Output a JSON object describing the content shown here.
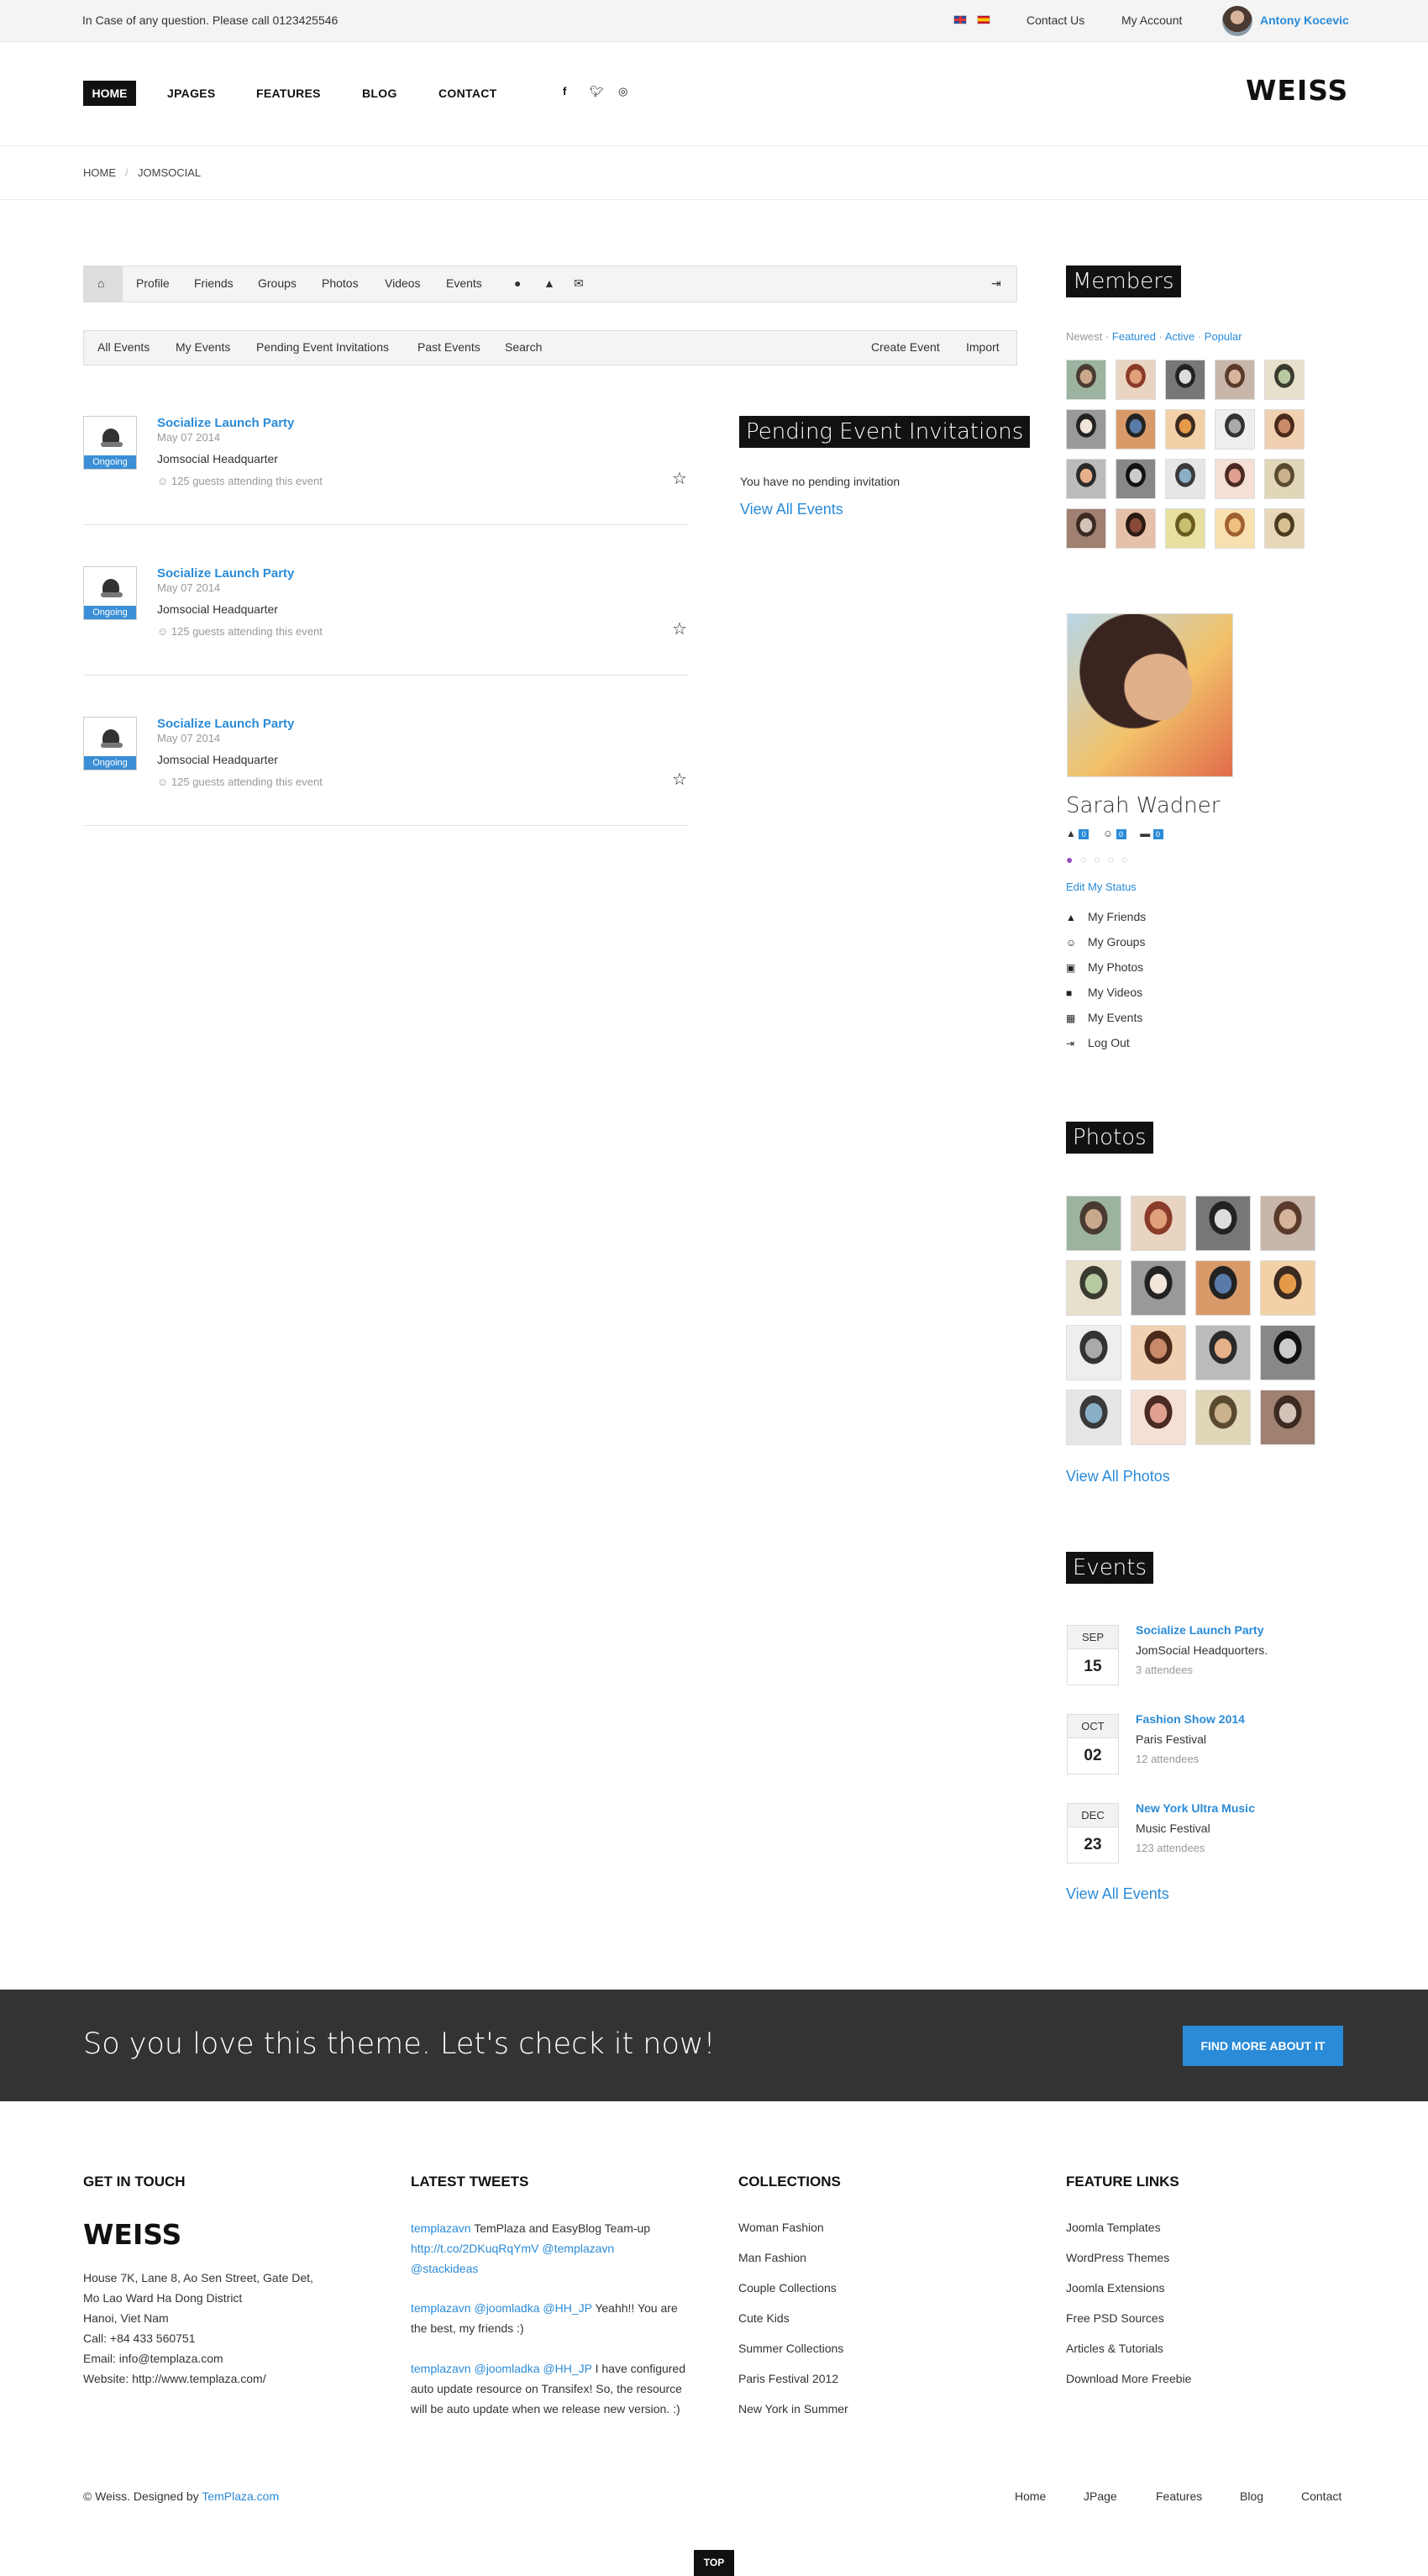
{
  "topbar": {
    "question": "In Case of any question. Please call 0123425546",
    "contact": "Contact Us",
    "account": "My Account",
    "user": "Antony Kocevic"
  },
  "nav": {
    "items": [
      "HOME",
      "JPAGES",
      "FEATURES",
      "BLOG",
      "CONTACT"
    ],
    "social": [
      "facebook-icon",
      "twitter-icon",
      "dribbble-icon"
    ]
  },
  "logo": "WEISS",
  "breadcrumb": [
    "HOME",
    "JOMSOCIAL"
  ],
  "toolbar_tabs": [
    "Profile",
    "Friends",
    "Groups",
    "Photos",
    "Videos",
    "Events"
  ],
  "subnav": {
    "left": [
      "All Events",
      "My Events",
      "Pending Event Invitations",
      "Past Events",
      "Search"
    ],
    "right": [
      "Create Event",
      "Import"
    ]
  },
  "events": [
    {
      "badge": "Ongoing",
      "title": "Socialize Launch Party",
      "date": "May 07 2014",
      "location": "Jomsocial Headquarter",
      "attending": "125 guests attending this event"
    },
    {
      "badge": "Ongoing",
      "title": "Socialize Launch Party",
      "date": "May 07 2014",
      "location": "Jomsocial Headquarter",
      "attending": "125 guests attending this event"
    },
    {
      "badge": "Ongoing",
      "title": "Socialize Launch Party",
      "date": "May 07 2014",
      "location": "Jomsocial Headquarter",
      "attending": "125 guests attending this event"
    }
  ],
  "pending": {
    "title": "Pending Event Invitations",
    "empty": "You have no pending invitation",
    "view_all": "View All Events"
  },
  "members": {
    "title": "Members",
    "filters": [
      "Newest",
      "Featured",
      "Active",
      "Popular"
    ]
  },
  "profile": {
    "name": "Sarah Wadner",
    "counts": [
      "0",
      "0",
      "0"
    ],
    "edit": "Edit My Status",
    "menu": [
      "My Friends",
      "My Groups",
      "My Photos",
      "My Videos",
      "My Events",
      "Log Out"
    ]
  },
  "photos": {
    "title": "Photos",
    "view_all": "View All Photos"
  },
  "side_events": {
    "title": "Events",
    "items": [
      {
        "month": "SEP",
        "day": "15",
        "title": "Socialize Launch Party",
        "place": "JomSocial Headquorters.",
        "attendees": "3 attendees"
      },
      {
        "month": "OCT",
        "day": "02",
        "title": "Fashion Show 2014",
        "place": "Paris Festival",
        "attendees": "12 attendees"
      },
      {
        "month": "DEC",
        "day": "23",
        "title": "New York Ultra Music",
        "place": "Music Festival",
        "attendees": "123 attendees"
      }
    ],
    "view_all": "View All Events"
  },
  "cta": {
    "text": "So you love this theme. Let's check it now!",
    "button": "FIND MORE ABOUT IT"
  },
  "footer": {
    "get_in_touch": {
      "heading": "GET IN TOUCH",
      "logo": "WEISS",
      "lines": [
        "House 7K, Lane 8, Ao Sen Street, Gate Det,",
        "Mo Lao Ward Ha Dong District",
        "Hanoi, Viet Nam",
        "Call: +84 433 560751",
        "Email: info@templaza.com",
        "Website: http://www.templaza.com/"
      ]
    },
    "tweets": {
      "heading": "LATEST TWEETS",
      "t1_user": "templazavn",
      "t1_text": "TemPlaza and EasyBlog Team-up",
      "t1_link": "http://t.co/2DKuqRqYmV @templazavn",
      "t1_link2": "@stackideas",
      "t2_user": "templazavn @joomladka @HH_JP",
      "t2_text": "Yeahh!! You are",
      "t2_text2": "the best, my friends :)",
      "t3_user": "templazavn @joomladka @HH_JP",
      "t3_text": "I have configured",
      "t3_text2": "auto update resource on Transifex! So, the resource",
      "t3_text3": "will be auto update when we release new version. :)"
    },
    "collections": {
      "heading": "COLLECTIONS",
      "items": [
        "Woman Fashion",
        "Man Fashion",
        "Couple Collections",
        "Cute Kids",
        "Summer Collections",
        "Paris Festival 2012",
        "New York in Summer"
      ]
    },
    "features": {
      "heading": "FEATURE LINKS",
      "items": [
        "Joomla Templates",
        "WordPress Themes",
        "Joomla Extensions",
        "Free PSD Sources",
        "Articles & Tutorials",
        "Download More Freebie"
      ]
    },
    "copyright": "© Weiss. Designed by",
    "copyright_link": "TemPlaza.com",
    "nav": [
      "Home",
      "JPage",
      "Features",
      "Blog",
      "Contact"
    ],
    "top": "TOP"
  }
}
